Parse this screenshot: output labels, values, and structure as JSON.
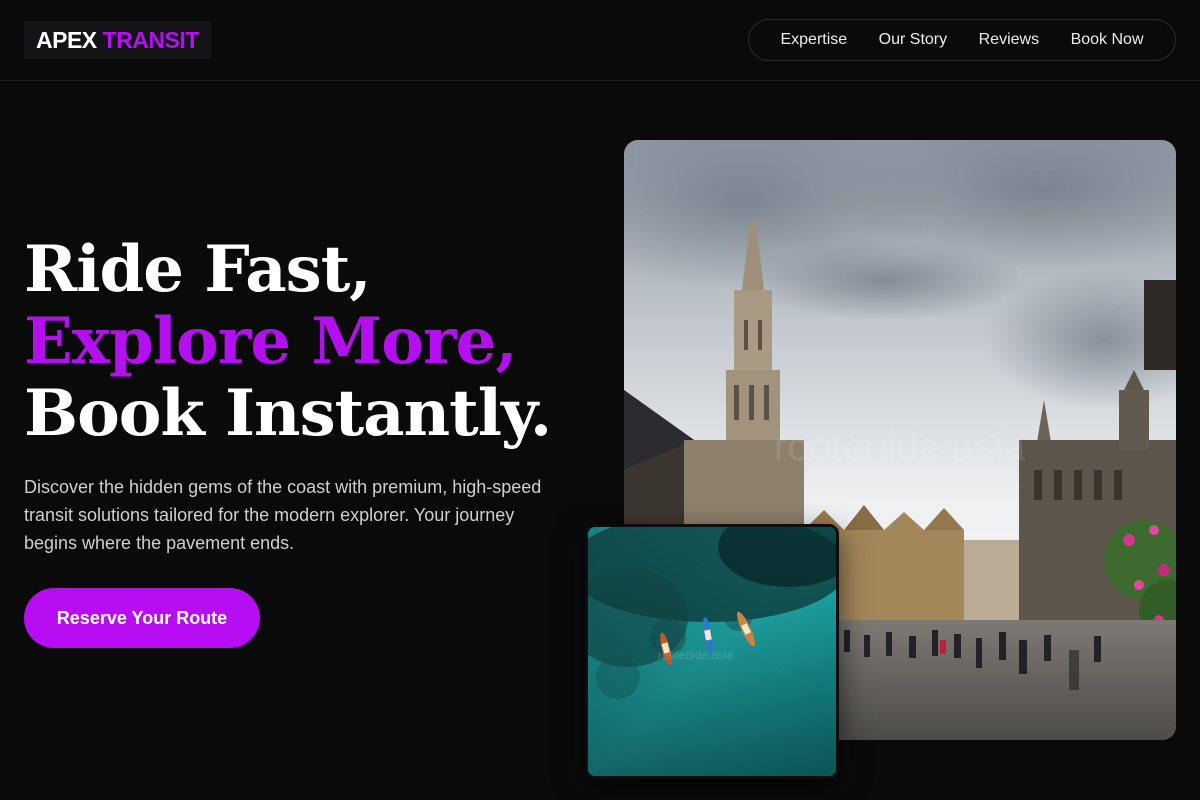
{
  "header": {
    "logo_primary": "APEX",
    "logo_accent": "TRANSIT",
    "nav": [
      {
        "label": "Expertise"
      },
      {
        "label": "Our Story"
      },
      {
        "label": "Reviews"
      },
      {
        "label": "Book Now"
      }
    ]
  },
  "hero": {
    "headline_line1": "Ride Fast,",
    "headline_line2": "Explore More,",
    "headline_line3": "Book Instantly.",
    "description": "Discover the hidden gems of the coast with premium, high-speed transit solutions tailored for the modern explorer. Your journey begins where the pavement ends.",
    "cta_label": "Reserve Your Route"
  },
  "images": {
    "main_watermark": "rootenide.asia",
    "inset_watermark": "rootenide.asia"
  },
  "colors": {
    "background": "#0a0a0b",
    "accent": "#b410ef",
    "button": "#b70df2",
    "text": "#ffffff",
    "muted_text": "#cfcfd3"
  }
}
